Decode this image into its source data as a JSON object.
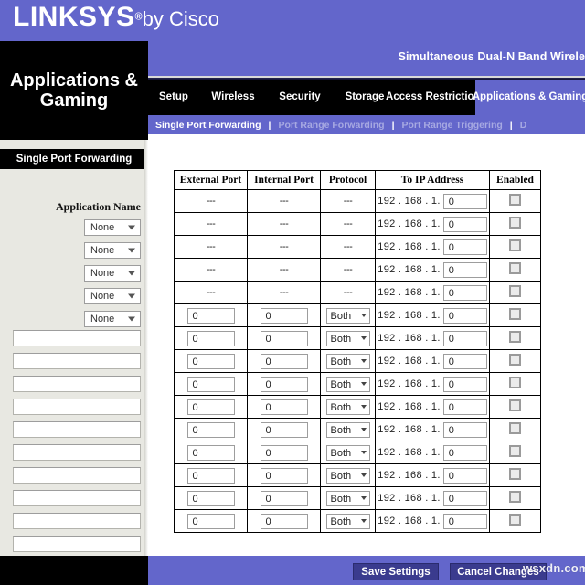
{
  "brand": {
    "logo_main": "LINKSYS",
    "logo_reg": "®",
    "logo_by": "by Cisco",
    "bar_color": "#6366cb"
  },
  "product": {
    "title": "Simultaneous Dual-N Band Wirele",
    "model_block": "Applications & Gaming"
  },
  "nav": {
    "tabs": [
      {
        "label": "Setup",
        "active": false
      },
      {
        "label": "Wireless",
        "active": false
      },
      {
        "label": "Security",
        "active": false
      },
      {
        "label": "Storage",
        "active": false
      },
      {
        "label": "Access Restrictions",
        "active": false
      },
      {
        "label": "Applications & Gaming",
        "active": true
      }
    ],
    "subnav": [
      {
        "label": "Single Port Forwarding",
        "active": true
      },
      {
        "label": "Port Range Forwarding",
        "active": false
      },
      {
        "label": "Port Range Triggering",
        "active": false
      },
      {
        "label": "D",
        "active": false
      }
    ],
    "separator": "|"
  },
  "sidebar": {
    "section_title": "Single Port Forwarding",
    "application_name_label": "Application Name",
    "selects": [
      {
        "value": "None"
      },
      {
        "value": "None"
      },
      {
        "value": "None"
      },
      {
        "value": "None"
      },
      {
        "value": "None"
      }
    ],
    "text_inputs": [
      {
        "value": ""
      },
      {
        "value": ""
      },
      {
        "value": ""
      },
      {
        "value": ""
      },
      {
        "value": ""
      },
      {
        "value": ""
      },
      {
        "value": ""
      },
      {
        "value": ""
      },
      {
        "value": ""
      },
      {
        "value": ""
      }
    ]
  },
  "table": {
    "headers": [
      "External Port",
      "Internal Port",
      "Protocol",
      "To IP Address",
      "Enabled"
    ],
    "ip_prefix": "192 . 168 . 1.",
    "placeholder_dash": "---",
    "rows": [
      {
        "type": "static",
        "external_port": "---",
        "internal_port": "---",
        "protocol": "---",
        "ip_octet": "0",
        "enabled": false
      },
      {
        "type": "static",
        "external_port": "---",
        "internal_port": "---",
        "protocol": "---",
        "ip_octet": "0",
        "enabled": false
      },
      {
        "type": "static",
        "external_port": "---",
        "internal_port": "---",
        "protocol": "---",
        "ip_octet": "0",
        "enabled": false
      },
      {
        "type": "static",
        "external_port": "---",
        "internal_port": "---",
        "protocol": "---",
        "ip_octet": "0",
        "enabled": false
      },
      {
        "type": "static",
        "external_port": "---",
        "internal_port": "---",
        "protocol": "---",
        "ip_octet": "0",
        "enabled": false
      },
      {
        "type": "input",
        "external_port": "0",
        "internal_port": "0",
        "protocol": "Both",
        "ip_octet": "0",
        "enabled": false
      },
      {
        "type": "input",
        "external_port": "0",
        "internal_port": "0",
        "protocol": "Both",
        "ip_octet": "0",
        "enabled": false
      },
      {
        "type": "input",
        "external_port": "0",
        "internal_port": "0",
        "protocol": "Both",
        "ip_octet": "0",
        "enabled": false
      },
      {
        "type": "input",
        "external_port": "0",
        "internal_port": "0",
        "protocol": "Both",
        "ip_octet": "0",
        "enabled": false
      },
      {
        "type": "input",
        "external_port": "0",
        "internal_port": "0",
        "protocol": "Both",
        "ip_octet": "0",
        "enabled": false
      },
      {
        "type": "input",
        "external_port": "0",
        "internal_port": "0",
        "protocol": "Both",
        "ip_octet": "0",
        "enabled": false
      },
      {
        "type": "input",
        "external_port": "0",
        "internal_port": "0",
        "protocol": "Both",
        "ip_octet": "0",
        "enabled": false
      },
      {
        "type": "input",
        "external_port": "0",
        "internal_port": "0",
        "protocol": "Both",
        "ip_octet": "0",
        "enabled": false
      },
      {
        "type": "input",
        "external_port": "0",
        "internal_port": "0",
        "protocol": "Both",
        "ip_octet": "0",
        "enabled": false
      },
      {
        "type": "input",
        "external_port": "0",
        "internal_port": "0",
        "protocol": "Both",
        "ip_octet": "0",
        "enabled": false
      }
    ]
  },
  "footer": {
    "save_label": "Save Settings",
    "cancel_label": "Cancel Changes",
    "watermark": "wsxdn.com"
  }
}
